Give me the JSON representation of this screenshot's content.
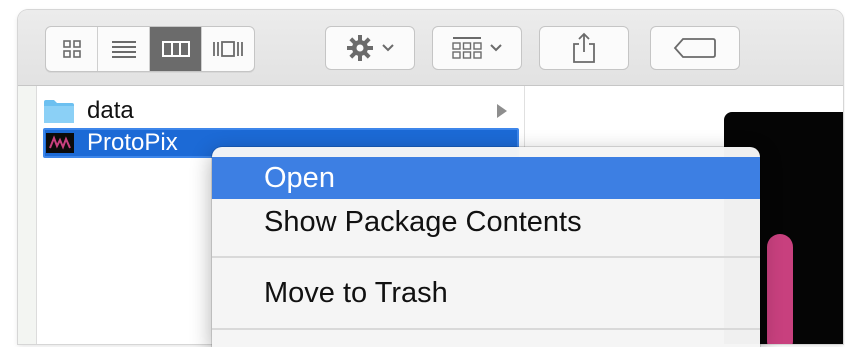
{
  "toolbar": {
    "view_buttons": [
      {
        "name": "icon-view",
        "icon": "grid-icon",
        "active": false
      },
      {
        "name": "list-view",
        "icon": "list-icon",
        "active": false
      },
      {
        "name": "column-view",
        "icon": "columns-icon",
        "active": true
      },
      {
        "name": "gallery-view",
        "icon": "cover-flow-icon",
        "active": false
      }
    ],
    "action_button_icon": "gear-icon",
    "arrange_button_icon": "arrange-grid-icon",
    "share_button_icon": "share-icon",
    "tags_button_icon": "tag-icon"
  },
  "browser": {
    "items": [
      {
        "label": "data",
        "icon": "folder-icon",
        "has_children": true,
        "selected": false
      },
      {
        "label": "ProtoPix",
        "icon": "app-icon",
        "selected": true
      }
    ]
  },
  "context_menu": {
    "items": [
      {
        "label": "Open",
        "highlighted": true
      },
      {
        "label": "Show Package Contents",
        "highlighted": false
      },
      {
        "label": "Move to Trash",
        "highlighted": false
      }
    ]
  },
  "colors": {
    "selection": "#1c6ad6",
    "menu_highlight": "#3d7fe3",
    "folder": "#6cc0f0",
    "preview_accent": "#c8407e"
  }
}
